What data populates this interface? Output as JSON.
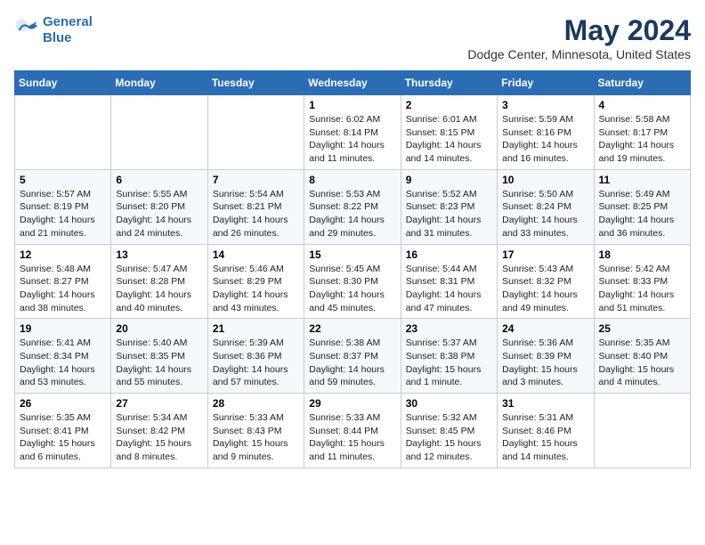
{
  "header": {
    "logo_line1": "General",
    "logo_line2": "Blue",
    "month_title": "May 2024",
    "location": "Dodge Center, Minnesota, United States"
  },
  "days_of_week": [
    "Sunday",
    "Monday",
    "Tuesday",
    "Wednesday",
    "Thursday",
    "Friday",
    "Saturday"
  ],
  "weeks": [
    [
      {
        "day": "",
        "sunrise": "",
        "sunset": "",
        "daylight": ""
      },
      {
        "day": "",
        "sunrise": "",
        "sunset": "",
        "daylight": ""
      },
      {
        "day": "",
        "sunrise": "",
        "sunset": "",
        "daylight": ""
      },
      {
        "day": "1",
        "sunrise": "Sunrise: 6:02 AM",
        "sunset": "Sunset: 8:14 PM",
        "daylight": "Daylight: 14 hours and 11 minutes."
      },
      {
        "day": "2",
        "sunrise": "Sunrise: 6:01 AM",
        "sunset": "Sunset: 8:15 PM",
        "daylight": "Daylight: 14 hours and 14 minutes."
      },
      {
        "day": "3",
        "sunrise": "Sunrise: 5:59 AM",
        "sunset": "Sunset: 8:16 PM",
        "daylight": "Daylight: 14 hours and 16 minutes."
      },
      {
        "day": "4",
        "sunrise": "Sunrise: 5:58 AM",
        "sunset": "Sunset: 8:17 PM",
        "daylight": "Daylight: 14 hours and 19 minutes."
      }
    ],
    [
      {
        "day": "5",
        "sunrise": "Sunrise: 5:57 AM",
        "sunset": "Sunset: 8:19 PM",
        "daylight": "Daylight: 14 hours and 21 minutes."
      },
      {
        "day": "6",
        "sunrise": "Sunrise: 5:55 AM",
        "sunset": "Sunset: 8:20 PM",
        "daylight": "Daylight: 14 hours and 24 minutes."
      },
      {
        "day": "7",
        "sunrise": "Sunrise: 5:54 AM",
        "sunset": "Sunset: 8:21 PM",
        "daylight": "Daylight: 14 hours and 26 minutes."
      },
      {
        "day": "8",
        "sunrise": "Sunrise: 5:53 AM",
        "sunset": "Sunset: 8:22 PM",
        "daylight": "Daylight: 14 hours and 29 minutes."
      },
      {
        "day": "9",
        "sunrise": "Sunrise: 5:52 AM",
        "sunset": "Sunset: 8:23 PM",
        "daylight": "Daylight: 14 hours and 31 minutes."
      },
      {
        "day": "10",
        "sunrise": "Sunrise: 5:50 AM",
        "sunset": "Sunset: 8:24 PM",
        "daylight": "Daylight: 14 hours and 33 minutes."
      },
      {
        "day": "11",
        "sunrise": "Sunrise: 5:49 AM",
        "sunset": "Sunset: 8:25 PM",
        "daylight": "Daylight: 14 hours and 36 minutes."
      }
    ],
    [
      {
        "day": "12",
        "sunrise": "Sunrise: 5:48 AM",
        "sunset": "Sunset: 8:27 PM",
        "daylight": "Daylight: 14 hours and 38 minutes."
      },
      {
        "day": "13",
        "sunrise": "Sunrise: 5:47 AM",
        "sunset": "Sunset: 8:28 PM",
        "daylight": "Daylight: 14 hours and 40 minutes."
      },
      {
        "day": "14",
        "sunrise": "Sunrise: 5:46 AM",
        "sunset": "Sunset: 8:29 PM",
        "daylight": "Daylight: 14 hours and 43 minutes."
      },
      {
        "day": "15",
        "sunrise": "Sunrise: 5:45 AM",
        "sunset": "Sunset: 8:30 PM",
        "daylight": "Daylight: 14 hours and 45 minutes."
      },
      {
        "day": "16",
        "sunrise": "Sunrise: 5:44 AM",
        "sunset": "Sunset: 8:31 PM",
        "daylight": "Daylight: 14 hours and 47 minutes."
      },
      {
        "day": "17",
        "sunrise": "Sunrise: 5:43 AM",
        "sunset": "Sunset: 8:32 PM",
        "daylight": "Daylight: 14 hours and 49 minutes."
      },
      {
        "day": "18",
        "sunrise": "Sunrise: 5:42 AM",
        "sunset": "Sunset: 8:33 PM",
        "daylight": "Daylight: 14 hours and 51 minutes."
      }
    ],
    [
      {
        "day": "19",
        "sunrise": "Sunrise: 5:41 AM",
        "sunset": "Sunset: 8:34 PM",
        "daylight": "Daylight: 14 hours and 53 minutes."
      },
      {
        "day": "20",
        "sunrise": "Sunrise: 5:40 AM",
        "sunset": "Sunset: 8:35 PM",
        "daylight": "Daylight: 14 hours and 55 minutes."
      },
      {
        "day": "21",
        "sunrise": "Sunrise: 5:39 AM",
        "sunset": "Sunset: 8:36 PM",
        "daylight": "Daylight: 14 hours and 57 minutes."
      },
      {
        "day": "22",
        "sunrise": "Sunrise: 5:38 AM",
        "sunset": "Sunset: 8:37 PM",
        "daylight": "Daylight: 14 hours and 59 minutes."
      },
      {
        "day": "23",
        "sunrise": "Sunrise: 5:37 AM",
        "sunset": "Sunset: 8:38 PM",
        "daylight": "Daylight: 15 hours and 1 minute."
      },
      {
        "day": "24",
        "sunrise": "Sunrise: 5:36 AM",
        "sunset": "Sunset: 8:39 PM",
        "daylight": "Daylight: 15 hours and 3 minutes."
      },
      {
        "day": "25",
        "sunrise": "Sunrise: 5:35 AM",
        "sunset": "Sunset: 8:40 PM",
        "daylight": "Daylight: 15 hours and 4 minutes."
      }
    ],
    [
      {
        "day": "26",
        "sunrise": "Sunrise: 5:35 AM",
        "sunset": "Sunset: 8:41 PM",
        "daylight": "Daylight: 15 hours and 6 minutes."
      },
      {
        "day": "27",
        "sunrise": "Sunrise: 5:34 AM",
        "sunset": "Sunset: 8:42 PM",
        "daylight": "Daylight: 15 hours and 8 minutes."
      },
      {
        "day": "28",
        "sunrise": "Sunrise: 5:33 AM",
        "sunset": "Sunset: 8:43 PM",
        "daylight": "Daylight: 15 hours and 9 minutes."
      },
      {
        "day": "29",
        "sunrise": "Sunrise: 5:33 AM",
        "sunset": "Sunset: 8:44 PM",
        "daylight": "Daylight: 15 hours and 11 minutes."
      },
      {
        "day": "30",
        "sunrise": "Sunrise: 5:32 AM",
        "sunset": "Sunset: 8:45 PM",
        "daylight": "Daylight: 15 hours and 12 minutes."
      },
      {
        "day": "31",
        "sunrise": "Sunrise: 5:31 AM",
        "sunset": "Sunset: 8:46 PM",
        "daylight": "Daylight: 15 hours and 14 minutes."
      },
      {
        "day": "",
        "sunrise": "",
        "sunset": "",
        "daylight": ""
      }
    ]
  ]
}
